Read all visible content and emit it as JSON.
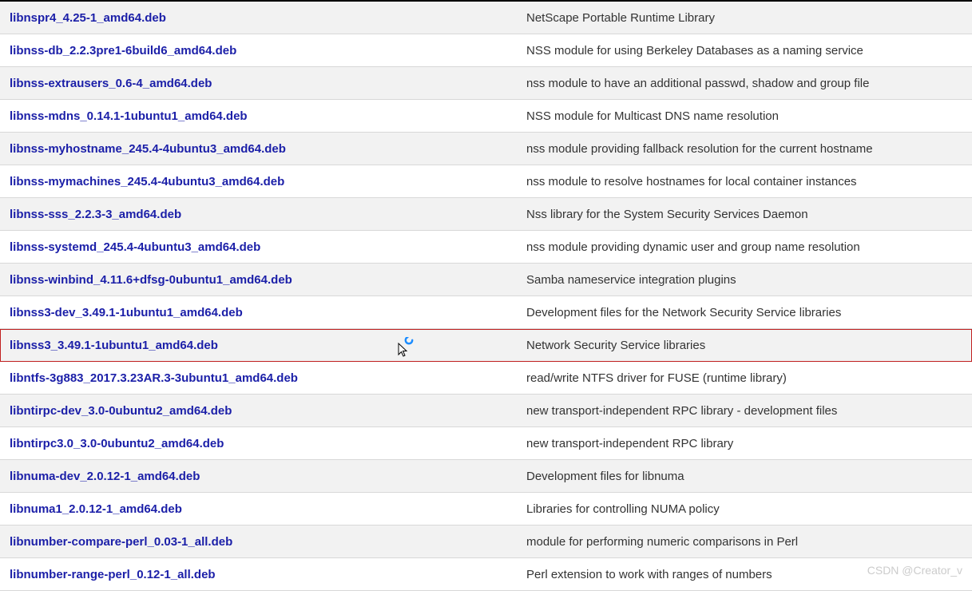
{
  "watermark": "CSDN @Creator_v",
  "packages": [
    {
      "name": "libnspr4_4.25-1_amd64.deb",
      "desc": "NetScape Portable Runtime Library",
      "highlight": false
    },
    {
      "name": "libnss-db_2.2.3pre1-6build6_amd64.deb",
      "desc": "NSS module for using Berkeley Databases as a naming service",
      "highlight": false
    },
    {
      "name": "libnss-extrausers_0.6-4_amd64.deb",
      "desc": "nss module to have an additional passwd, shadow and group file",
      "highlight": false
    },
    {
      "name": "libnss-mdns_0.14.1-1ubuntu1_amd64.deb",
      "desc": "NSS module for Multicast DNS name resolution",
      "highlight": false
    },
    {
      "name": "libnss-myhostname_245.4-4ubuntu3_amd64.deb",
      "desc": "nss module providing fallback resolution for the current hostname",
      "highlight": false
    },
    {
      "name": "libnss-mymachines_245.4-4ubuntu3_amd64.deb",
      "desc": "nss module to resolve hostnames for local container instances",
      "highlight": false
    },
    {
      "name": "libnss-sss_2.2.3-3_amd64.deb",
      "desc": "Nss library for the System Security Services Daemon",
      "highlight": false
    },
    {
      "name": "libnss-systemd_245.4-4ubuntu3_amd64.deb",
      "desc": "nss module providing dynamic user and group name resolution",
      "highlight": false
    },
    {
      "name": "libnss-winbind_4.11.6+dfsg-0ubuntu1_amd64.deb",
      "desc": "Samba nameservice integration plugins",
      "highlight": false
    },
    {
      "name": "libnss3-dev_3.49.1-1ubuntu1_amd64.deb",
      "desc": "Development files for the Network Security Service libraries",
      "highlight": false
    },
    {
      "name": "libnss3_3.49.1-1ubuntu1_amd64.deb",
      "desc": "Network Security Service libraries",
      "highlight": true
    },
    {
      "name": "libntfs-3g883_2017.3.23AR.3-3ubuntu1_amd64.deb",
      "desc": "read/write NTFS driver for FUSE (runtime library)",
      "highlight": false
    },
    {
      "name": "libntirpc-dev_3.0-0ubuntu2_amd64.deb",
      "desc": "new transport-independent RPC library - development files",
      "highlight": false
    },
    {
      "name": "libntirpc3.0_3.0-0ubuntu2_amd64.deb",
      "desc": "new transport-independent RPC library",
      "highlight": false
    },
    {
      "name": "libnuma-dev_2.0.12-1_amd64.deb",
      "desc": "Development files for libnuma",
      "highlight": false
    },
    {
      "name": "libnuma1_2.0.12-1_amd64.deb",
      "desc": "Libraries for controlling NUMA policy",
      "highlight": false
    },
    {
      "name": "libnumber-compare-perl_0.03-1_all.deb",
      "desc": "module for performing numeric comparisons in Perl",
      "highlight": false
    },
    {
      "name": "libnumber-range-perl_0.12-1_all.deb",
      "desc": "Perl extension to work with ranges of numbers",
      "highlight": false
    }
  ]
}
